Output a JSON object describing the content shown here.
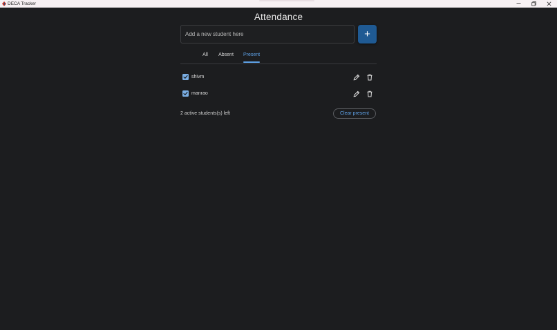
{
  "window": {
    "title": "DECA Tracker",
    "icon": "deca-logo-icon",
    "controls": [
      "minimize-icon",
      "restore-icon",
      "close-icon"
    ]
  },
  "page": {
    "title": "Attendance"
  },
  "new_student": {
    "placeholder": "Add a new student here",
    "value": "",
    "add_button_label": "+"
  },
  "tabs": [
    {
      "label": "All",
      "active": false
    },
    {
      "label": "Absent",
      "active": false
    },
    {
      "label": "Present",
      "active": true
    }
  ],
  "students": [
    {
      "name": "shivm",
      "checked": true,
      "icons": [
        "pencil-icon",
        "trash-icon"
      ]
    },
    {
      "name": "manrao",
      "checked": true,
      "icons": [
        "pencil-icon",
        "trash-icon"
      ]
    }
  ],
  "footer": {
    "count_text": "2 active students(s) left",
    "clear_button_label": "Clear present"
  },
  "colors": {
    "background": "#1c1d1f",
    "accent": "#5ea1e6",
    "add_button": "#1f5a93",
    "checkbox": "#7aaee3",
    "titlebar": "#f7f1f3"
  }
}
